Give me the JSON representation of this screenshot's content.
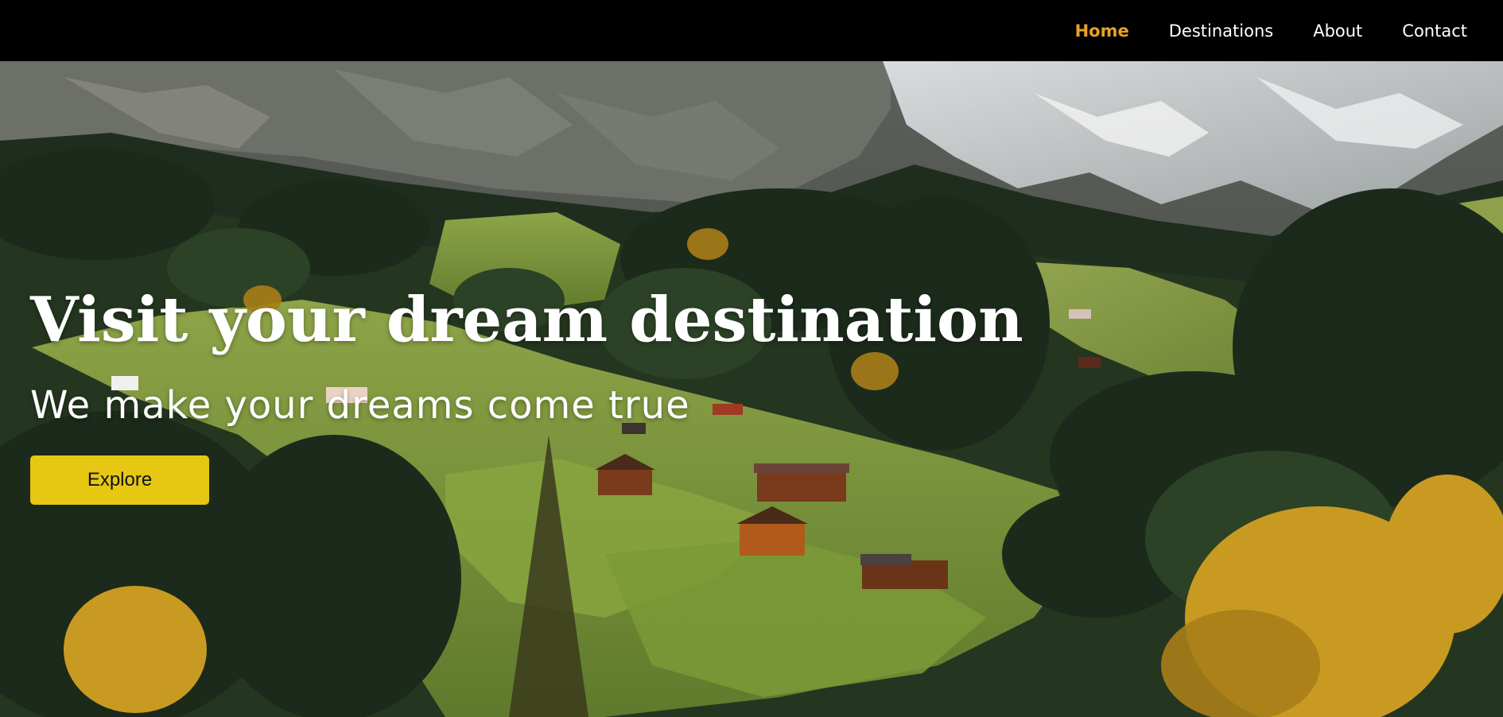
{
  "nav": {
    "items": [
      {
        "label": "Home",
        "active": true
      },
      {
        "label": "Destinations",
        "active": false
      },
      {
        "label": "About",
        "active": false
      },
      {
        "label": "Contact",
        "active": false
      }
    ],
    "background": "#000000",
    "active_color": "#e8a12a"
  },
  "hero": {
    "title": "Visit your dream destination",
    "subtitle": "We make your dreams come true",
    "cta_label": "Explore",
    "cta_color": "#e6c812"
  }
}
